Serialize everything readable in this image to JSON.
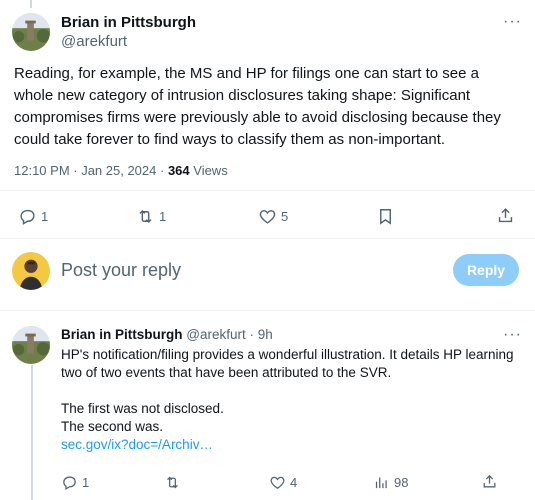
{
  "main_tweet": {
    "author_name": "Brian in Pittsburgh",
    "author_handle": "@arekfurt",
    "more_glyph": "···",
    "text": "Reading, for example, the MS and HP for filings one can start to see a whole new category of intrusion disclosures taking shape: Significant compromises firms were previously able to avoid disclosing because they could take forever to find ways to classify them as non-important.",
    "timestamp": "12:10 PM · Jan 25, 2024 · ",
    "views_count": "364",
    "views_label": " Views",
    "actions": {
      "reply_count": "1",
      "retweet_count": "1",
      "like_count": "5",
      "bookmark_count": "",
      "share_count": ""
    }
  },
  "composer": {
    "placeholder": "Post your reply",
    "button_label": "Reply"
  },
  "reply_tweet": {
    "author_name": "Brian in Pittsburgh",
    "author_handle": "@arekfurt",
    "time_ago": "· 9h",
    "more_glyph": "···",
    "paragraph1": "HP's notification/filing provides a wonderful illustration. It details HP learning two of two events that have been attributed to the SVR.",
    "line2": "The first was not disclosed.",
    "line3": "The second was.",
    "link": "sec.gov/ix?doc=/Archiv…",
    "actions": {
      "reply_count": "1",
      "retweet_count": "",
      "like_count": "4",
      "views_count": "98"
    }
  },
  "colors": {
    "text_primary": "#0f1419",
    "text_secondary": "#536471",
    "link": "#1d9bf0",
    "reply_button_disabled": "#8ecdf8"
  }
}
